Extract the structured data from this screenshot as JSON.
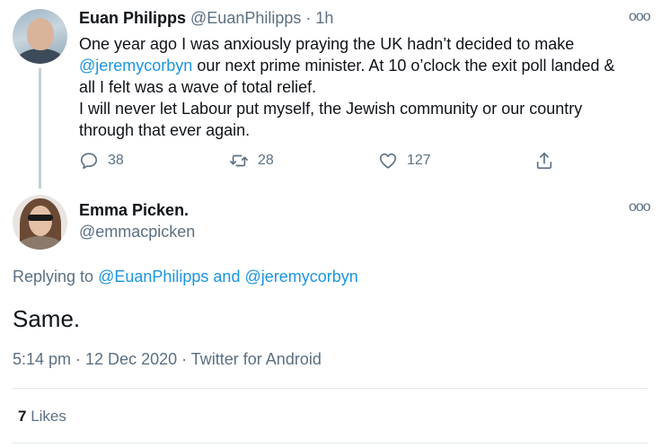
{
  "parent_tweet": {
    "author_name": "Euan Philipps",
    "author_handle": "@EuanPhilipps",
    "separator": "·",
    "time_ago": "1h",
    "more_label": "ooo",
    "text_line_1_prefix": "One year ago I was anxiously praying the UK hadn’t decided to make",
    "text_mention": "@jeremycorbyn",
    "text_line_2_suffix": " our next prime minister. At 10 o’clock the exit poll landed &",
    "text_line_3": "all I felt was a wave of total relief.",
    "text_line_4": "I will never let Labour put myself, the Jewish community or our country",
    "text_line_5": "through that ever again.",
    "reply_count": "38",
    "retweet_count": "28",
    "like_count": "127",
    "icons": [
      "reply-icon",
      "retweet-icon",
      "like-icon",
      "share-icon"
    ]
  },
  "reply_tweet": {
    "author_name": "Emma Picken.",
    "author_handle": "@emmacpicken",
    "more_label": "ooo",
    "replying_prefix": "Replying to ",
    "replying_user_1": "@EuanPhilipps",
    "replying_and": " and ",
    "replying_user_2": "@jeremycorbyn",
    "body": "Same.",
    "timestamp": "5:14 pm · 12 Dec 2020 · Twitter for Android",
    "likes_count": "7",
    "likes_label": "Likes"
  },
  "colors": {
    "link": "#1b95e0",
    "muted": "#5b7083",
    "text": "#0f1419",
    "thread_line": "#c4cfd6",
    "divider": "#e1e8ed"
  }
}
